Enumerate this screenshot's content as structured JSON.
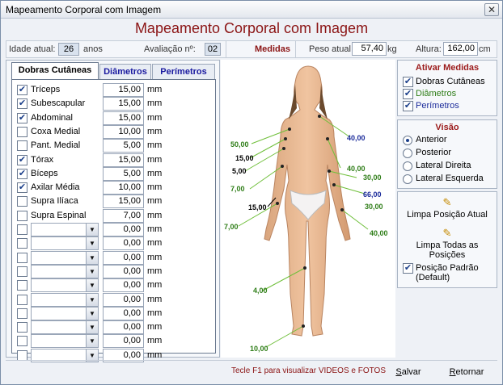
{
  "window": {
    "title": "Mapeamento Corporal com Imagem",
    "close_glyph": "✕"
  },
  "heading": "Mapeamento Corporal com Imagem",
  "info": {
    "idade_label": "Idade atual:",
    "idade_value": "26",
    "anos_label": "anos",
    "avaliacao_label": "Avaliação nº:",
    "avaliacao_value": "02",
    "medidas_label": "Medidas",
    "peso_label": "Peso atual:",
    "peso_value": "57,40",
    "peso_unit": "kg",
    "altura_label": "Altura:",
    "altura_value": "162,00",
    "altura_unit": "cm"
  },
  "tabs": [
    {
      "label": "Dobras Cutâneas",
      "active": true
    },
    {
      "label": "Diâmetros",
      "active": false
    },
    {
      "label": "Perímetros",
      "active": false
    }
  ],
  "measures": [
    {
      "name": "Tríceps",
      "checked": true,
      "value": "15,00",
      "unit": "mm"
    },
    {
      "name": "Subescapular",
      "checked": true,
      "value": "15,00",
      "unit": "mm"
    },
    {
      "name": "Abdominal",
      "checked": true,
      "value": "15,00",
      "unit": "mm"
    },
    {
      "name": "Coxa Medial",
      "checked": false,
      "value": "10,00",
      "unit": "mm"
    },
    {
      "name": "Pant. Medial",
      "checked": false,
      "value": "5,00",
      "unit": "mm"
    },
    {
      "name": "Tórax",
      "checked": true,
      "value": "15,00",
      "unit": "mm"
    },
    {
      "name": "Bíceps",
      "checked": true,
      "value": "5,00",
      "unit": "mm"
    },
    {
      "name": "Axilar Média",
      "checked": true,
      "value": "10,00",
      "unit": "mm"
    },
    {
      "name": "Supra Ilíaca",
      "checked": false,
      "value": "15,00",
      "unit": "mm"
    },
    {
      "name": "Supra Espinal",
      "checked": false,
      "value": "7,00",
      "unit": "mm"
    }
  ],
  "extra_rows": [
    {
      "value": "0,00",
      "unit": "mm"
    },
    {
      "value": "0,00",
      "unit": "mm"
    },
    {
      "value": "0,00",
      "unit": "mm"
    },
    {
      "value": "0,00",
      "unit": "mm"
    },
    {
      "value": "0,00",
      "unit": "mm"
    },
    {
      "value": "0,00",
      "unit": "mm"
    },
    {
      "value": "0,00",
      "unit": "mm"
    },
    {
      "value": "0,00",
      "unit": "mm"
    },
    {
      "value": "0,00",
      "unit": "mm"
    },
    {
      "value": "0,00",
      "unit": "mm"
    }
  ],
  "figure_labels": [
    {
      "text": "50,00",
      "color": "#2e7d17"
    },
    {
      "text": "15,00",
      "color": "#000000"
    },
    {
      "text": "5,00",
      "color": "#000000"
    },
    {
      "text": "7,00",
      "color": "#2e7d17"
    },
    {
      "text": "15,00",
      "color": "#000000"
    },
    {
      "text": "7,00",
      "color": "#2e7d17"
    },
    {
      "text": "4,00",
      "color": "#2e7d17"
    },
    {
      "text": "10,00",
      "color": "#2e7d17"
    },
    {
      "text": "40,00",
      "color": "#1a2a9a"
    },
    {
      "text": "40,00",
      "color": "#2e7d17"
    },
    {
      "text": "30,00",
      "color": "#2e7d17"
    },
    {
      "text": "66,00",
      "color": "#1a2a9a"
    },
    {
      "text": "30,00",
      "color": "#2e7d17"
    },
    {
      "text": "40,00",
      "color": "#2e7d17"
    }
  ],
  "ativar": {
    "title": "Ativar Medidas",
    "items": [
      {
        "label": "Dobras Cutâneas",
        "checked": true,
        "color": "#000000"
      },
      {
        "label": "Diâmetros",
        "checked": true,
        "color": "#2e7d17"
      },
      {
        "label": "Perímetros",
        "checked": true,
        "color": "#1a2a9a"
      }
    ]
  },
  "visao": {
    "title": "Visão",
    "options": [
      {
        "label": "Anterior",
        "selected": true
      },
      {
        "label": "Posterior",
        "selected": false
      },
      {
        "label": "Lateral Direita",
        "selected": false
      },
      {
        "label": "Lateral Esquerda",
        "selected": false
      }
    ]
  },
  "actions": {
    "limpa_atual": "Limpa Posição Atual",
    "limpa_todas": "Limpa Todas as Posições",
    "posicao_padrao": "Posição Padrão (Default)",
    "posicao_padrao_checked": true
  },
  "footer": {
    "hint": "Tecle F1 para visualizar VIDEOS e FOTOS",
    "salvar": "Salvar",
    "retornar": "Retornar"
  }
}
